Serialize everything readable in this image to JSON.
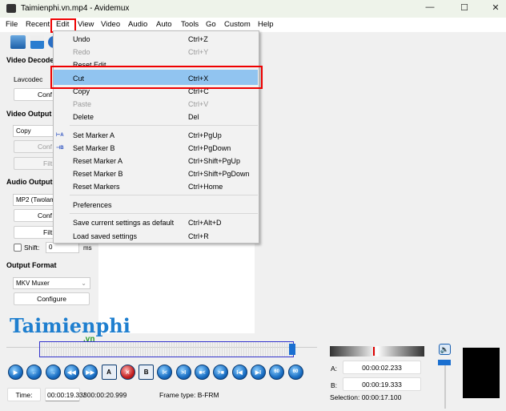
{
  "window": {
    "title": "Taimienphi.vn.mp4 - Avidemux",
    "minimize": "—",
    "maximize": "☐",
    "close": "✕"
  },
  "menubar": [
    "File",
    "Recent",
    "Edit",
    "View",
    "Video",
    "Audio",
    "Auto",
    "Tools",
    "Go",
    "Custom",
    "Help"
  ],
  "left": {
    "video_decoder": "Video Decoder",
    "lavcodec": "Lavcodec",
    "configure_short": "Conf",
    "video_output": "Video Output",
    "video_output_value": "Copy",
    "filters_short": "Filt",
    "audio_output": "Audio Output",
    "audio_output_value": "MP2 (Twolame)",
    "shift_label": "Shift:",
    "shift_value": "0",
    "shift_unit": "ms",
    "output_format": "Output Format",
    "output_format_value": "MKV Muxer",
    "configure": "Configure"
  },
  "edit_menu": {
    "items": [
      {
        "label": "Undo",
        "shortcut": "Ctrl+Z",
        "enabled": true
      },
      {
        "label": "Redo",
        "shortcut": "Ctrl+Y",
        "enabled": false
      },
      {
        "label": "Reset Edit",
        "shortcut": "",
        "enabled": true
      },
      {
        "label": "Cut",
        "shortcut": "Ctrl+X",
        "enabled": true,
        "highlighted": true
      },
      {
        "label": "Copy",
        "shortcut": "Ctrl+C",
        "enabled": true
      },
      {
        "label": "Paste",
        "shortcut": "Ctrl+V",
        "enabled": false
      },
      {
        "label": "Delete",
        "shortcut": "Del",
        "enabled": true
      },
      {
        "label": "Set Marker A",
        "shortcut": "Ctrl+PgUp",
        "enabled": true
      },
      {
        "label": "Set Marker B",
        "shortcut": "Ctrl+PgDown",
        "enabled": true
      },
      {
        "label": "Reset Marker A",
        "shortcut": "Ctrl+Shift+PgUp",
        "enabled": true
      },
      {
        "label": "Reset Marker B",
        "shortcut": "Ctrl+Shift+PgDown",
        "enabled": true
      },
      {
        "label": "Reset Markers",
        "shortcut": "Ctrl+Home",
        "enabled": true
      },
      {
        "label": "Preferences",
        "shortcut": "",
        "enabled": true
      },
      {
        "label": "Save current settings as default",
        "shortcut": "Ctrl+Alt+D",
        "enabled": true
      },
      {
        "label": "Load saved settings",
        "shortcut": "Ctrl+R",
        "enabled": true
      }
    ]
  },
  "watermark": {
    "text": "Taimienphi",
    "suffix": ".vn"
  },
  "controls": [
    "play",
    "previous-frame",
    "next-frame",
    "rewind",
    "fast-forward",
    "set-marker-a",
    "delete",
    "set-marker-b",
    "go-marker-a",
    "go-marker-b",
    "prev-keyframe",
    "next-keyframe",
    "go-start",
    "go-end",
    "back-60",
    "forward-60"
  ],
  "control_labels": {
    "marker_a": "A",
    "marker_b": "B",
    "sixty": "60"
  },
  "status": {
    "time_button": "Time:",
    "current_time": "00:00:19.333",
    "total_time": "/ 00:00:20.999",
    "frame_type": "Frame type:  B-FRM"
  },
  "markers": {
    "a_label": "A:",
    "a_value": "00:00:02.233",
    "b_label": "B:",
    "b_value": "00:00:19.333",
    "selection": "Selection: 00:00:17.100"
  },
  "colors": {
    "highlight": "#91c4f0",
    "annotation": "#e00000",
    "accent": "#1a6fc4"
  }
}
